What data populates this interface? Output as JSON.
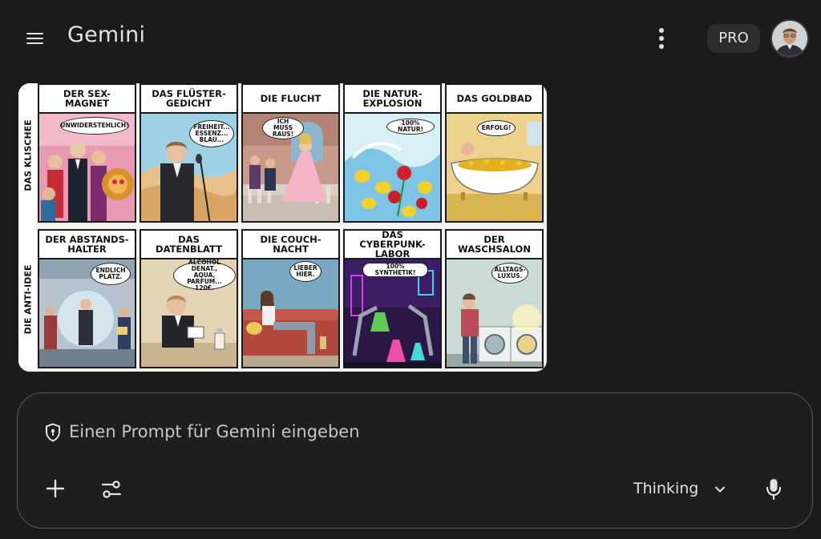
{
  "header": {
    "app_title": "Gemini",
    "menu_icon": "hamburger-menu-icon",
    "more_icon": "more-vert-icon",
    "plan_badge": "PRO",
    "avatar_icon": "user-avatar"
  },
  "comic": {
    "rows": [
      {
        "label": "DAS KLISCHEE",
        "panels": [
          {
            "title": "DER SEX-MAGNET",
            "bubble": "UNWIDERSTEHLICH!"
          },
          {
            "title": "DAS FLÜSTER-\nGEDICHT",
            "bubble": "FREIHEIT...\nESSENZ...\nBLAU..."
          },
          {
            "title": "DIE FLUCHT",
            "bubble": "ICH MUSS\nRAUS!"
          },
          {
            "title": "DIE NATUR-\nEXPLOSION",
            "bubble": "100% NATUR!"
          },
          {
            "title": "DAS GOLDBAD",
            "bubble": "ERFOLG!"
          }
        ]
      },
      {
        "label": "DIE ANTI-IDEE",
        "panels": [
          {
            "title": "DER ABSTANDS-\nHALTER",
            "bubble": "ENDLICH\nPLATZ."
          },
          {
            "title": "DAS DATENBLATT",
            "bubble": "ALCOHOL DENAT.,\nAQUA, PARFUM...\n120€."
          },
          {
            "title": "DIE COUCH-NACHT",
            "bubble": "LIEBER\nHIER."
          },
          {
            "title": "DAS CYBERPUNK-\nLABOR",
            "bubble": "100% SYNTHETIK!"
          },
          {
            "title": "DER WASCHSALON",
            "bubble": "ALLTAGS-\nLUXUS."
          }
        ]
      }
    ]
  },
  "composer": {
    "placeholder": "Einen Prompt für Gemini eingeben",
    "shield_icon": "shield-icon",
    "add_icon": "plus-icon",
    "tools_icon": "tune-icon",
    "model_label": "Thinking",
    "model_chevron_icon": "chevron-down-icon",
    "mic_icon": "microphone-icon"
  },
  "colors": {
    "background": "#1b1b1b",
    "composer_border": "#5a5a5a",
    "text": "#e3e3e3",
    "badge_bg": "#2c2c2c"
  }
}
